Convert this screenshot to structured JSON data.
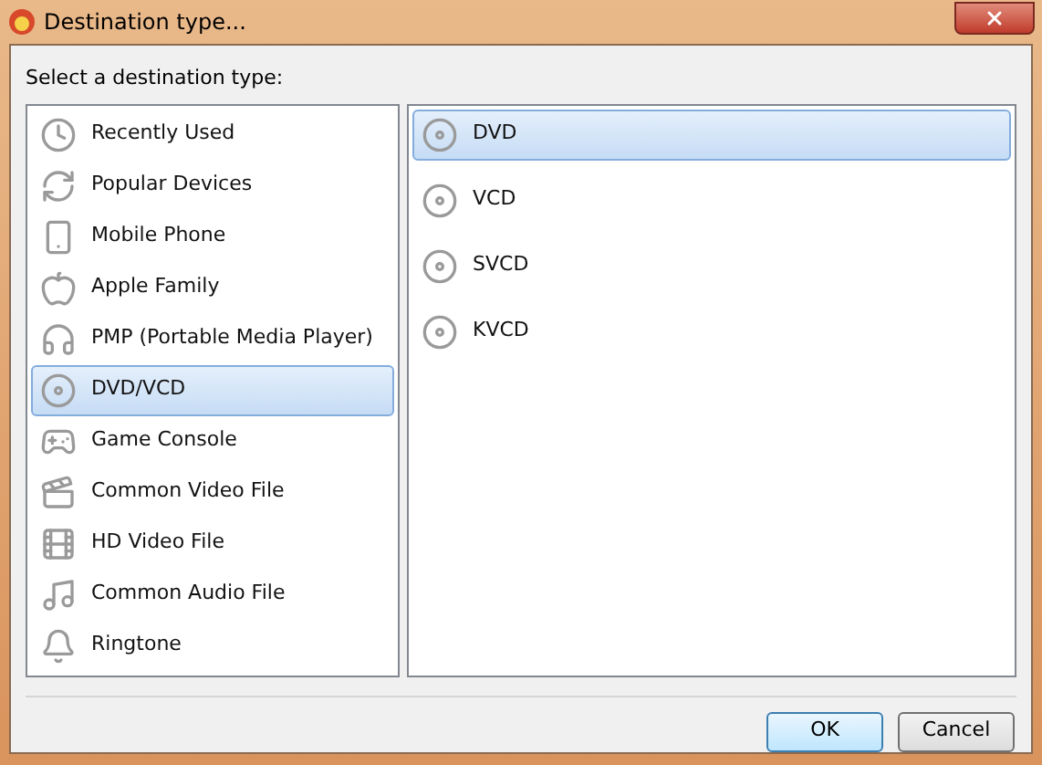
{
  "window": {
    "title": "Destination type..."
  },
  "prompt": "Select a destination type:",
  "categories": [
    {
      "label": "Recently Used",
      "kind": "recent",
      "selected": false
    },
    {
      "label": "Popular Devices",
      "kind": "popular",
      "selected": false
    },
    {
      "label": "Mobile Phone",
      "kind": "mobile",
      "selected": false
    },
    {
      "label": "Apple Family",
      "kind": "apple",
      "selected": false
    },
    {
      "label": "PMP (Portable Media Player)",
      "kind": "pmp",
      "selected": false
    },
    {
      "label": "DVD/VCD",
      "kind": "disc",
      "selected": true
    },
    {
      "label": "Game Console",
      "kind": "game",
      "selected": false
    },
    {
      "label": "Common Video File",
      "kind": "video",
      "selected": false
    },
    {
      "label": "HD Video File",
      "kind": "hd",
      "selected": false
    },
    {
      "label": "Common Audio File",
      "kind": "audio",
      "selected": false
    },
    {
      "label": "Ringtone",
      "kind": "ringtone",
      "selected": false
    }
  ],
  "formats": [
    {
      "label": "DVD",
      "selected": true
    },
    {
      "label": "VCD",
      "selected": false
    },
    {
      "label": "SVCD",
      "selected": false
    },
    {
      "label": "KVCD",
      "selected": false
    }
  ],
  "buttons": [
    {
      "label": "OK",
      "default": true
    },
    {
      "label": "Cancel",
      "default": false
    }
  ]
}
